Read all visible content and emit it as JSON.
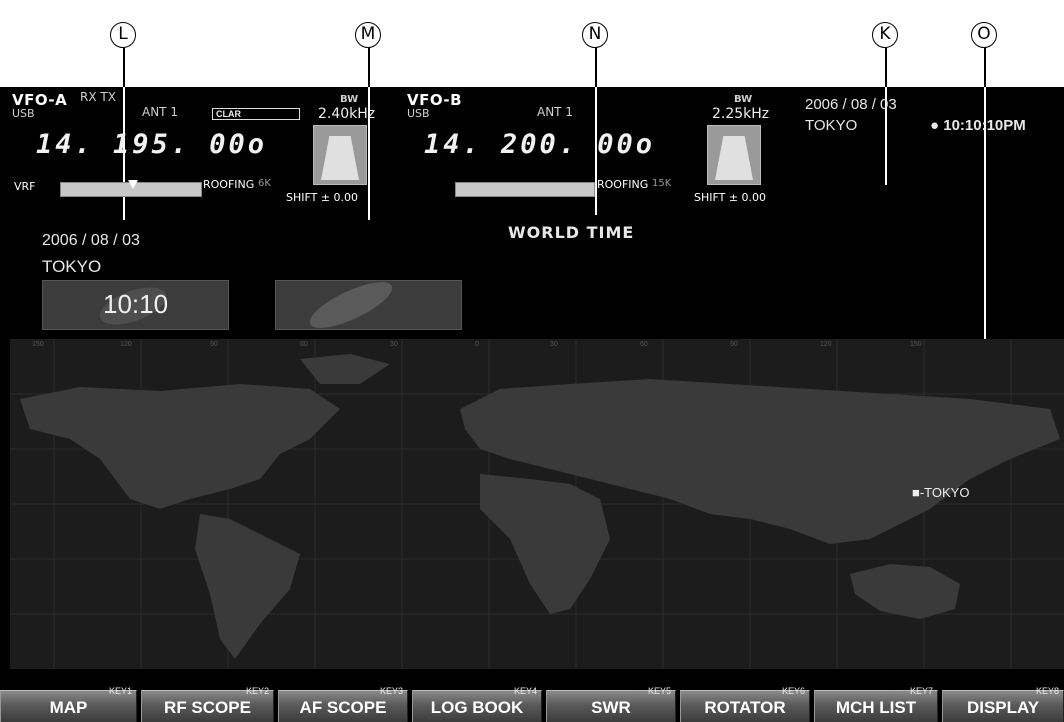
{
  "callouts": [
    "L",
    "M",
    "N",
    "K",
    "O"
  ],
  "vfo_a": {
    "name": "VFO-A",
    "rxtx": "RX TX",
    "mode": "USB",
    "antenna": "ANT 1",
    "clar": "CLAR",
    "bw_label": "BW",
    "bw_value": "2.40kHz",
    "frequency": "14. 195. 00o",
    "vrf": "VRF",
    "roofing": "ROOFING",
    "roofing_value": "6K",
    "shift": "SHIFT ± 0.00"
  },
  "vfo_b": {
    "name": "VFO-B",
    "mode": "USB",
    "antenna": "ANT 1",
    "bw_label": "BW",
    "bw_value": "2.25kHz",
    "frequency": "14. 200. 00o",
    "roofing": "ROOFING",
    "roofing_value": "15K",
    "shift": "SHIFT ± 0.00"
  },
  "top_right": {
    "date": "2006 / 08 / 03",
    "city": "TOKYO",
    "time": "● 10:10:10PM"
  },
  "world_time": {
    "title": "WORLD TIME",
    "date": "2006 / 08 / 03",
    "city": "TOKYO",
    "time": "10:10"
  },
  "map": {
    "longitude_labels": [
      "150",
      "120",
      "90",
      "60",
      "30",
      "0",
      "30",
      "60",
      "90",
      "120",
      "150"
    ],
    "marker_label": "■-TOKYO"
  },
  "function_keys": [
    {
      "label": "MAP",
      "key": "KEY1"
    },
    {
      "label": "RF SCOPE",
      "key": "KEY2"
    },
    {
      "label": "AF SCOPE",
      "key": "KEY3"
    },
    {
      "label": "LOG BOOK",
      "key": "KEY4"
    },
    {
      "label": "SWR",
      "key": "KEY5"
    },
    {
      "label": "ROTATOR",
      "key": "KEY6"
    },
    {
      "label": "MCH LIST",
      "key": "KEY7"
    },
    {
      "label": "DISPLAY",
      "key": "KEY8"
    }
  ],
  "colors": {
    "screen_bg": "#000000",
    "map_bg": "#1c1c1c",
    "land": "#3a3a3a",
    "key_gradient_top": "#8a8a8a"
  }
}
